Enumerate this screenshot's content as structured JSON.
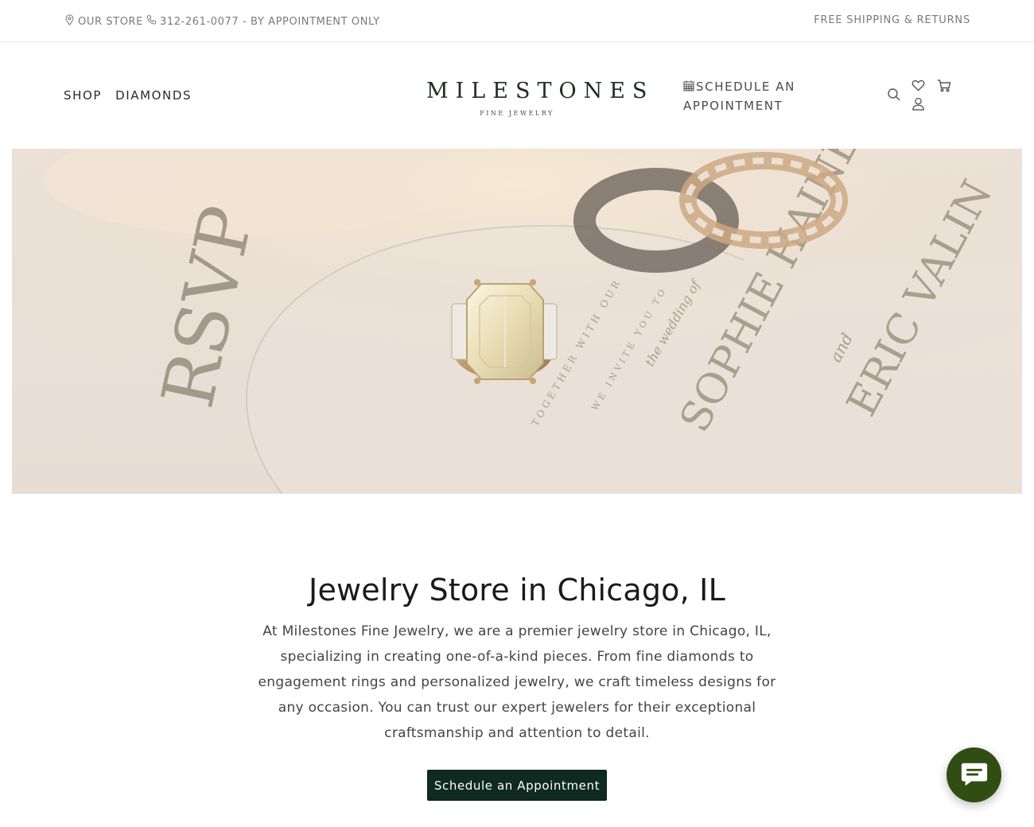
{
  "topbar": {
    "store_label": "OUR STORE",
    "phone_text": "312-261-0077 - BY APPOINTMENT ONLY",
    "shipping_text": "FREE SHIPPING & RETURNS"
  },
  "nav": {
    "shop_label": "SHOP",
    "diamonds_label": "DIAMONDS"
  },
  "logo": {
    "main": "MILESTONES",
    "sub": "FINE JEWELRY"
  },
  "header": {
    "schedule_line1": "SCHEDULE AN",
    "schedule_line2": "APPOINTMENT",
    "icons": [
      "calendar-icon",
      "search-icon",
      "heart-icon",
      "cart-icon",
      "user-icon"
    ]
  },
  "hero": {
    "invitation_text": {
      "rsvp": "RSVP",
      "together": "TOGETHER WITH OUR",
      "invite": "WE INVITE YOU TO",
      "wedding": "the wedding of",
      "name1": "SOPHIE HAINES",
      "and": "and",
      "name2": "ERIC VALIN"
    }
  },
  "content": {
    "heading": "Jewelry Store in Chicago, IL",
    "body": "At Milestones Fine Jewelry, we are a premier jewelry store in Chicago, IL, specializing in creating one-of-a-kind pieces. From fine diamonds to engagement rings and personalized jewelry, we craft timeless designs for any occasion. You can trust our expert jewelers for their exceptional craftsmanship and attention to detail.",
    "cta_label": "Schedule an Appointment"
  },
  "colors": {
    "cta_bg": "#0e2a21",
    "chat_bg": "#304e13",
    "muted_text": "#7a7a7a"
  }
}
